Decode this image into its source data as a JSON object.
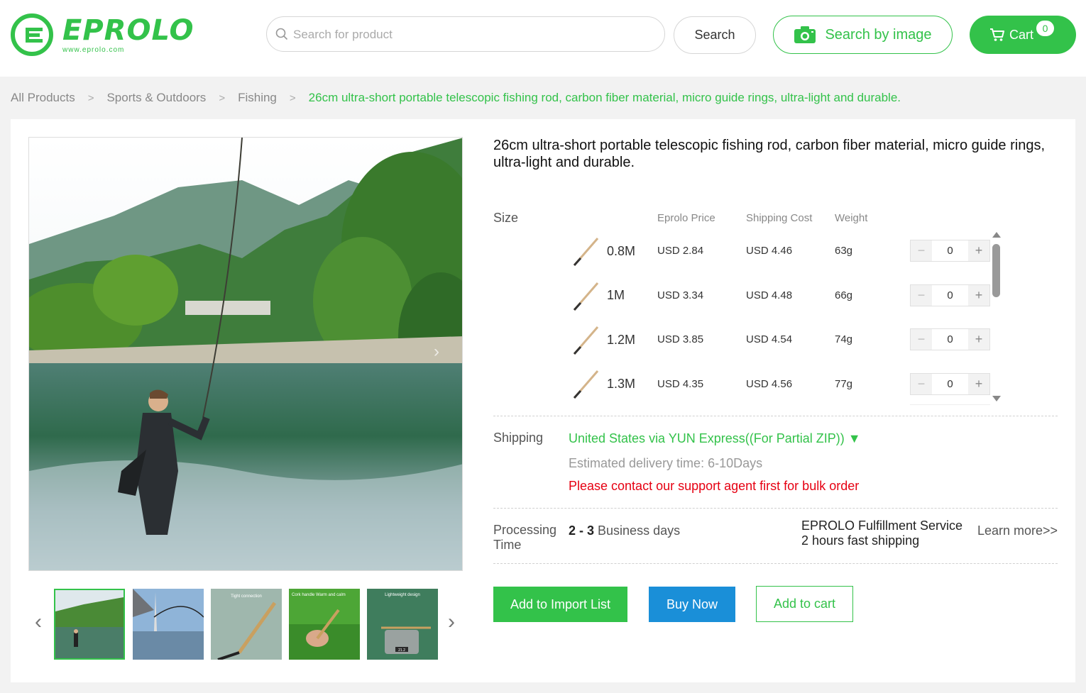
{
  "brand": {
    "name": "EPROLO",
    "url": "www.eprolo.com",
    "accent": "#33c24a"
  },
  "header": {
    "search_placeholder": "Search for product",
    "search_label": "Search",
    "image_search_label": "Search by image",
    "cart_label": "Cart",
    "cart_count": "0"
  },
  "breadcrumb": {
    "items": [
      "All Products",
      "Sports & Outdoors",
      "Fishing"
    ],
    "current": "26cm ultra-short portable telescopic fishing rod, carbon fiber material, micro guide rings, ultra-light and durable."
  },
  "product": {
    "title": "26cm ultra-short portable telescopic fishing rod, carbon fiber material, micro guide rings, ultra-light and durable.",
    "size_label": "Size",
    "columns": {
      "price": "Eprolo Price",
      "shipping": "Shipping Cost",
      "weight": "Weight"
    },
    "variants": [
      {
        "size": "0.8M",
        "price": "USD 2.84",
        "shipping": "USD 4.46",
        "weight": "63g",
        "qty": "0"
      },
      {
        "size": "1M",
        "price": "USD 3.34",
        "shipping": "USD 4.48",
        "weight": "66g",
        "qty": "0"
      },
      {
        "size": "1.2M",
        "price": "USD 3.85",
        "shipping": "USD 4.54",
        "weight": "74g",
        "qty": "0"
      },
      {
        "size": "1.3M",
        "price": "USD 4.35",
        "shipping": "USD 4.56",
        "weight": "77g",
        "qty": "0"
      }
    ],
    "stepper_minus": "−",
    "stepper_plus": "+",
    "shipping_label": "Shipping",
    "shipping_method": "United States via YUN Express((For Partial ZIP)) ▼",
    "estimated_delivery": "Estimated delivery time: 6-10Days",
    "bulk_notice": "Please contact our support agent first for bulk order",
    "processing_label_1": "Processing",
    "processing_label_2": "Time",
    "processing_days": "2 - 3",
    "processing_unit": " Business days",
    "fulfillment_title": "EPROLO Fulfillment Service",
    "fulfillment_sub": "2 hours fast shipping",
    "learn_more": "Learn more>>",
    "buttons": {
      "import": "Add to Import List",
      "buy": "Buy Now",
      "cart": "Add to cart"
    }
  },
  "gallery": {
    "thumbnails": [
      {
        "caption": ""
      },
      {
        "caption": ""
      },
      {
        "caption": "Tight connection"
      },
      {
        "caption": "Cork handle Warm and calm"
      },
      {
        "caption": "Lightweight design"
      }
    ],
    "scale_reading": "21.2"
  },
  "colors": {
    "green": "#33c24a",
    "blue": "#1a8fd8",
    "red": "#e60012"
  }
}
